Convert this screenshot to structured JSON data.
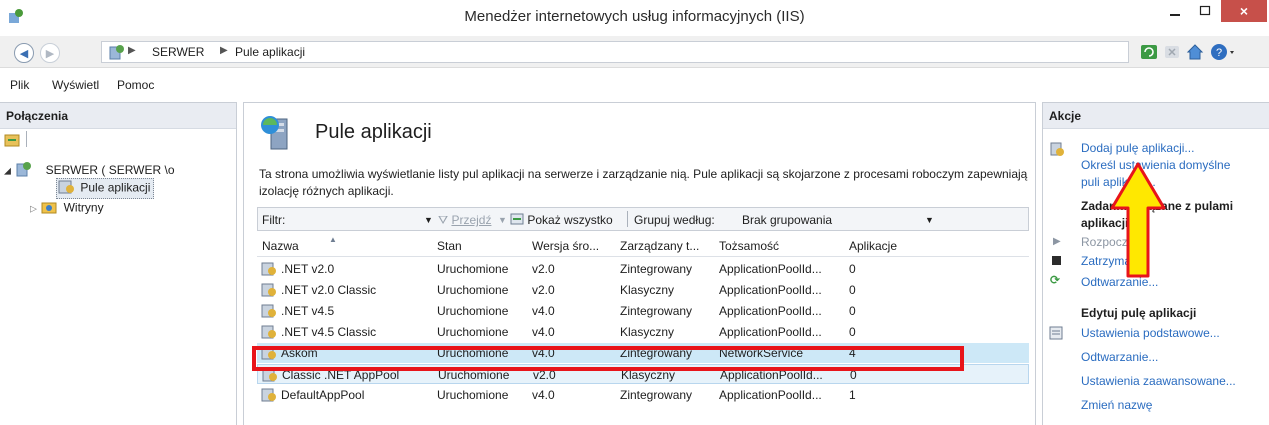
{
  "window": {
    "title": "Menedżer internetowych usług informacyjnych (IIS)",
    "close_glyph": "×"
  },
  "address": {
    "crumbs": [
      "SERWER",
      "Pule aplikacji"
    ]
  },
  "menu": {
    "items": [
      "Plik",
      "Wyświetl",
      "Pomoc"
    ]
  },
  "connections": {
    "title": "Połączenia",
    "tree": {
      "server": "SERWER (  SERWER \\o",
      "pools": "Pule aplikacji",
      "sites": "Witryny"
    }
  },
  "center": {
    "title": "Pule aplikacji",
    "description": "Ta strona umożliwia wyświetlanie listy pul aplikacji na serwerze i zarządzanie nią. Pule aplikacji są skojarzone z procesami roboczym zapewniają izolację różnych aplikacji.",
    "filter": {
      "label": "Filtr:",
      "go": "Przejdź",
      "show_all": "Pokaż wszystko",
      "group_by": "Grupuj według:",
      "group_value": "Brak grupowania"
    },
    "columns": [
      "Nazwa",
      "Stan",
      "Wersja śro...",
      "Zarządzany t...",
      "Tożsamość",
      "Aplikacje"
    ],
    "rows": [
      [
        ".NET v2.0",
        "Uruchomione",
        "v2.0",
        "Zintegrowany",
        "ApplicationPoolId...",
        "0"
      ],
      [
        ".NET v2.0 Classic",
        "Uruchomione",
        "v2.0",
        "Klasyczny",
        "ApplicationPoolId...",
        "0"
      ],
      [
        ".NET v4.5",
        "Uruchomione",
        "v4.0",
        "Zintegrowany",
        "ApplicationPoolId...",
        "0"
      ],
      [
        ".NET v4.5 Classic",
        "Uruchomione",
        "v4.0",
        "Klasyczny",
        "ApplicationPoolId...",
        "0"
      ],
      [
        "Askom",
        "Uruchomione",
        "v4.0",
        "Zintegrowany",
        "NetworkService",
        "4"
      ],
      [
        "Classic .NET AppPool",
        "Uruchomione",
        "v2.0",
        "Klasyczny",
        "ApplicationPoolId...",
        "0"
      ],
      [
        "DefaultAppPool",
        "Uruchomione",
        "v4.0",
        "Zintegrowany",
        "ApplicationPoolId...",
        "1"
      ]
    ]
  },
  "actions": {
    "title": "Akcje",
    "add_pool": "Dodaj pulę aplikacji...",
    "defaults_1": "Określ ustawienia domyślne",
    "defaults_2": "puli aplikacji...",
    "tasks_1": "Zadania związane z pulami",
    "tasks_2": "aplikacji",
    "start": "Rozpocznij",
    "stop": "Zatrzymaj",
    "recycle": "Odtwarzanie...",
    "edit_head": "Edytuj pulę aplikacji",
    "basic": "Ustawienia podstawowe...",
    "recycling": "Odtwarzanie...",
    "advanced": "Ustawienia zaawansowane...",
    "rename": "Zmień nazwę"
  },
  "colors": {
    "link": "#2a6cc0",
    "highlight_border": "#e8141a",
    "arrow_fill": "#ffe800",
    "arrow_stroke": "#e8141a"
  }
}
